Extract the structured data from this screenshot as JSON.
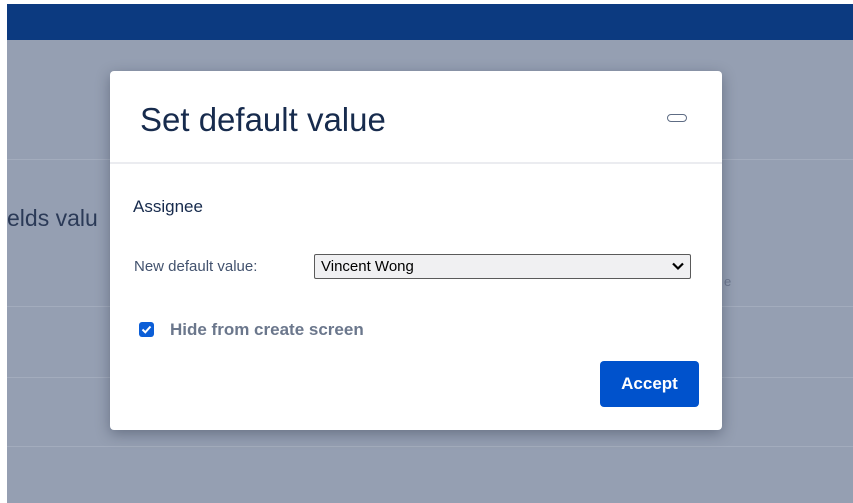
{
  "background": {
    "heading_fragment": "elds valu",
    "column_fragment": "e"
  },
  "modal": {
    "title": "Set default value",
    "minimize_icon": "minimize-icon",
    "field_name": "Assignee",
    "new_default_label": "New default value:",
    "new_default_value": "Vincent Wong",
    "hide_from_create_label": "Hide from create screen",
    "hide_from_create_checked": true,
    "accept_label": "Accept"
  },
  "colors": {
    "topbar": "#0c3a80",
    "overlay": "#959fb2",
    "primary_button": "#0052cc",
    "checkbox": "#0b5ed7"
  }
}
